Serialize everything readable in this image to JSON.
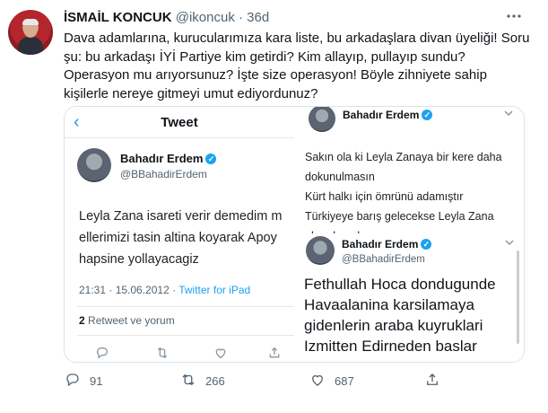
{
  "tweet": {
    "author_name": "İSMAİL KONCUK",
    "author_handle": "@ikoncuk",
    "separator": "·",
    "time": "36d",
    "lines": [
      "Dava adamlarına, kurucularımıza kara liste, bu arkadaşlara divan üyeliği! Soru",
      "şu: bu arkadaşı  İYİ Partiye kim getirdi? Kim allayıp, pullayıp sundu?",
      "Operasyon mu arıyorsunuz? İşte size operasyon! Böyle zihniyete sahip",
      "kişilerle nereye gitmeyi umut ediyordunuz?"
    ],
    "actions": {
      "reply_count": "91",
      "retweet_count": "266",
      "like_count": "687"
    }
  },
  "media": {
    "image1": {
      "nav_title": "Tweet",
      "back_glyph": "‹",
      "user_name": "Bahadır Erdem",
      "user_handle": "@BBahadirErdem",
      "lines": [
        "Leyla Zana isareti verir demedim m",
        "ellerimizi tasin altina koyarak Apoy",
        "hapsine yollayacagiz"
      ],
      "meta_time": "21:31 · 15.06.2012 · ",
      "meta_source": "Twitter for iPad",
      "retweet_count": "2",
      "retweet_label": " Retweet ve yorum"
    },
    "image2": {
      "user_name": "Bahadır Erdem",
      "lines": [
        "Sakın ola ki Leyla Zanaya bir kere daha",
        "dokunulmasın",
        "Kürt halkı için ömrünü adamıştır",
        "Türkiyeye barış gelecekse Leyla Zana",
        "olmadan olmaz"
      ]
    },
    "image3": {
      "user_name": "Bahadır Erdem",
      "user_handle": "@BBahadirErdem",
      "lines": [
        "Fethullah Hoca dondugunde",
        "Havaalanina karsilamaya",
        "gidenlerin araba kuyruklari",
        "Izmitten Edirneden baslar"
      ]
    }
  },
  "colors": {
    "accent": "#1da1f2",
    "muted": "#536471",
    "text": "#0f1419"
  },
  "icons": [
    "more-icon",
    "verified-badge-icon",
    "reply-icon",
    "retweet-icon",
    "like-icon",
    "share-icon",
    "back-arrow-icon",
    "chevron-down-icon"
  ]
}
